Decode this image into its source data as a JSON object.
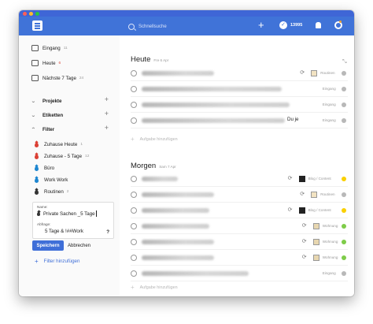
{
  "window": {
    "traffic_lights": [
      "#fe5f57",
      "#febc2e",
      "#28c840"
    ]
  },
  "topbar": {
    "background": "#4073d8",
    "search_placeholder": "Schnellsuche",
    "karma_value": "13995"
  },
  "sidebar": {
    "nav": [
      {
        "label": "Eingang",
        "count": "11",
        "icon": "inbox-icon"
      },
      {
        "label": "Heute",
        "count": "6",
        "icon": "calendar-today-icon"
      },
      {
        "label": "Nächste 7 Tage",
        "count": "24",
        "icon": "calendar-week-icon"
      }
    ],
    "sections": [
      {
        "label": "Projekte"
      },
      {
        "label": "Etiketten"
      },
      {
        "label": "Filter"
      }
    ],
    "filters": [
      {
        "label": "Zuhause Heute",
        "count": "1",
        "color": "#db4035"
      },
      {
        "label": "Zuhause - 5 Tage",
        "count": "12",
        "color": "#db4035"
      },
      {
        "label": "Büro",
        "count": "",
        "color": "#1d86d0"
      },
      {
        "label": "Work Work",
        "count": "",
        "color": "#1d86d0"
      },
      {
        "label": "Routinen",
        "count": "2",
        "color": "#333333"
      }
    ],
    "edit_filter": {
      "name_label": "Name:",
      "name_value": "Private Sachen _5 Tage",
      "query_label": "Abfrage:",
      "query_value": "5 Tage & !##Work",
      "help": "?",
      "save_label": "Speichern",
      "cancel_label": "Abbrechen"
    },
    "add_filter_label": "Filter hinzufügen"
  },
  "main": {
    "today": {
      "title": "Heute",
      "date": "Fre 6 Apr",
      "tasks": [
        {
          "text": "",
          "recurring": true,
          "project": "Routinen",
          "dot": "#b8b8b8",
          "thumb": "sec"
        },
        {
          "text": "",
          "recurring": false,
          "project": "Eingang",
          "dot": "#b8b8b8",
          "thumb": ""
        },
        {
          "text": "",
          "recurring": false,
          "project": "Eingang",
          "dot": "#b8b8b8",
          "thumb": ""
        },
        {
          "text": "Du je",
          "recurring": false,
          "project": "Eingang",
          "dot": "#b8b8b8",
          "thumb": ""
        }
      ],
      "add_task_label": "Aufgabe hinzufügen"
    },
    "tomorrow": {
      "title": "Morgen",
      "date": "Sam 7 Apr",
      "tasks": [
        {
          "text": "",
          "recurring": true,
          "project": "Blog / Content",
          "dot": "#fad000",
          "thumb": "dark"
        },
        {
          "text": "",
          "recurring": true,
          "project": "Routinen",
          "dot": "#b8b8b8",
          "thumb": "sec"
        },
        {
          "text": "",
          "recurring": true,
          "project": "Blog / Content",
          "dot": "#fad000",
          "thumb": "dark"
        },
        {
          "text": "",
          "recurring": true,
          "project": "Wohnung",
          "dot": "#7ecc49",
          "thumb": "home"
        },
        {
          "text": "",
          "recurring": true,
          "project": "Wohnung",
          "dot": "#7ecc49",
          "thumb": "home"
        },
        {
          "text": "",
          "recurring": true,
          "project": "Wohnung",
          "dot": "#7ecc49",
          "thumb": "home"
        },
        {
          "text": "",
          "recurring": false,
          "project": "Eingang",
          "dot": "#b8b8b8",
          "thumb": ""
        }
      ],
      "add_task_label": "Aufgabe hinzufügen"
    }
  }
}
